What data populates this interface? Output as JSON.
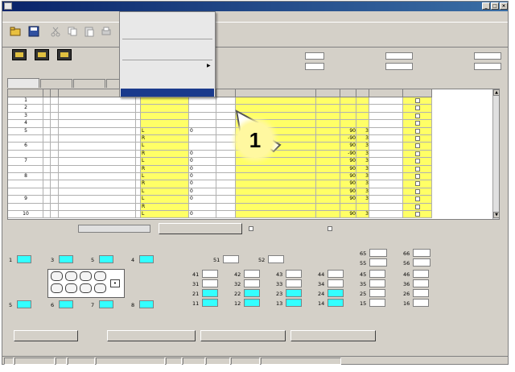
{
  "window": {
    "title": ""
  },
  "menu": [
    "",
    "",
    "",
    "",
    "",
    ""
  ],
  "toolbar": {
    "buttons": [
      "",
      "",
      "",
      "",
      "",
      ""
    ]
  },
  "dropdown": {
    "items": [
      "",
      "",
      "",
      "",
      "",
      "",
      "",
      ""
    ]
  },
  "slots": [
    "",
    "",
    ""
  ],
  "summary": {
    "row1": [
      {
        "label": "",
        "value": ""
      },
      {
        "label": "",
        "value": ""
      },
      {
        "label": "",
        "value": ""
      }
    ],
    "row2": [
      {
        "label": "",
        "value": ""
      },
      {
        "label": "",
        "value": ""
      },
      {
        "label": "",
        "value": ""
      }
    ]
  },
  "tabs": [
    "",
    "",
    "",
    ""
  ],
  "grid": {
    "headers": [
      "",
      "",
      "",
      "",
      "",
      "",
      "",
      "",
      "",
      "",
      "",
      "",
      "",
      ""
    ],
    "rows": [
      {
        "n": "1",
        "m": "",
        "t": "",
        "c": "",
        "d": "",
        "e": "",
        "f": "",
        "g": "",
        "h": "",
        "i": ""
      },
      {
        "n": "2",
        "m": "",
        "t": "",
        "c": "",
        "d": "",
        "e": "",
        "f": "",
        "g": "",
        "h": "",
        "i": ""
      },
      {
        "n": "3",
        "m": "",
        "t": "",
        "c": "",
        "d": "",
        "e": "",
        "f": "",
        "g": "",
        "h": "",
        "i": ""
      },
      {
        "n": "4",
        "m": "",
        "t": "",
        "c": "",
        "d": "",
        "e": "",
        "f": "",
        "g": "",
        "h": "",
        "i": ""
      },
      {
        "n": "5",
        "m": "",
        "t": "L",
        "c": "",
        "d": "0",
        "e": "",
        "f": "",
        "g": "90",
        "h": "3",
        "i": ""
      },
      {
        "n": "",
        "m": "",
        "t": "R",
        "c": "",
        "d": "",
        "e": "",
        "f": "",
        "g": "-90",
        "h": "3",
        "i": ""
      },
      {
        "n": "6",
        "m": "",
        "t": "L",
        "c": "",
        "d": "",
        "e": "",
        "f": "",
        "g": "90",
        "h": "3",
        "i": ""
      },
      {
        "n": "",
        "m": "",
        "t": "R",
        "c": "",
        "d": "0",
        "e": "",
        "f": "",
        "g": "-90",
        "h": "3",
        "i": ""
      },
      {
        "n": "7",
        "m": "",
        "t": "L",
        "c": "",
        "d": "0",
        "e": "",
        "f": "",
        "g": "90",
        "h": "3",
        "i": ""
      },
      {
        "n": "",
        "m": "",
        "t": "R",
        "c": "",
        "d": "0",
        "e": "",
        "f": "",
        "g": "90",
        "h": "3",
        "i": ""
      },
      {
        "n": "8",
        "m": "",
        "t": "L",
        "c": "",
        "d": "0",
        "e": "",
        "f": "",
        "g": "90",
        "h": "3",
        "i": ""
      },
      {
        "n": "",
        "m": "",
        "t": "R",
        "c": "",
        "d": "0",
        "e": "",
        "f": "",
        "g": "90",
        "h": "3",
        "i": ""
      },
      {
        "n": "",
        "m": "",
        "t": "L",
        "c": "",
        "d": "0",
        "e": "",
        "f": "",
        "g": "90",
        "h": "3",
        "i": ""
      },
      {
        "n": "9",
        "m": "",
        "t": "L",
        "c": "",
        "d": "0",
        "e": "",
        "f": "",
        "g": "90",
        "h": "3",
        "i": ""
      },
      {
        "n": "",
        "m": "",
        "t": "R",
        "c": "",
        "d": "",
        "e": "",
        "f": "",
        "g": "",
        "h": "",
        "i": ""
      },
      {
        "n": "10",
        "m": "",
        "t": "L",
        "c": "",
        "d": "0",
        "e": "",
        "f": "",
        "g": "90",
        "h": "3",
        "i": ""
      }
    ]
  },
  "mode": {
    "label": "",
    "value": "",
    "set_button": "",
    "check1": "",
    "check2": ""
  },
  "left_panel": {
    "title": "",
    "rows": [
      [
        "1",
        "",
        "3",
        "",
        "5",
        "",
        "4",
        ""
      ],
      [
        "5",
        "",
        "6",
        "",
        "7",
        "",
        "8",
        ""
      ]
    ],
    "keys": [
      "",
      "",
      "",
      "",
      "",
      "",
      "",
      ""
    ],
    "arrow": "•"
  },
  "right_panel": {
    "title": "",
    "top": [
      [
        "51",
        ""
      ],
      [
        "52",
        ""
      ]
    ],
    "pairs": [
      [
        "65",
        ""
      ],
      [
        "66",
        ""
      ],
      [
        "55",
        ""
      ],
      [
        "56",
        ""
      ]
    ],
    "cols": [
      [
        [
          "41",
          ""
        ],
        [
          "31",
          ""
        ],
        [
          "21",
          ""
        ],
        [
          "11",
          ""
        ]
      ],
      [
        [
          "42",
          ""
        ],
        [
          "32",
          ""
        ],
        [
          "22",
          ""
        ],
        [
          "12",
          ""
        ]
      ],
      [
        [
          "43",
          ""
        ],
        [
          "33",
          ""
        ],
        [
          "23",
          ""
        ],
        [
          "13",
          ""
        ]
      ],
      [
        [
          "44",
          ""
        ],
        [
          "34",
          ""
        ],
        [
          "24",
          ""
        ],
        [
          "14",
          ""
        ]
      ],
      [
        [
          "45",
          ""
        ],
        [
          "35",
          ""
        ],
        [
          "25",
          ""
        ],
        [
          "15",
          ""
        ]
      ],
      [
        [
          "46",
          ""
        ],
        [
          "36",
          ""
        ],
        [
          "26",
          ""
        ],
        [
          "16",
          ""
        ]
      ]
    ]
  },
  "bottom_buttons": [
    "",
    "",
    "",
    ""
  ],
  "callout_number": "1",
  "status": [
    "",
    "",
    "",
    "",
    "",
    "",
    "",
    "",
    "",
    ""
  ]
}
